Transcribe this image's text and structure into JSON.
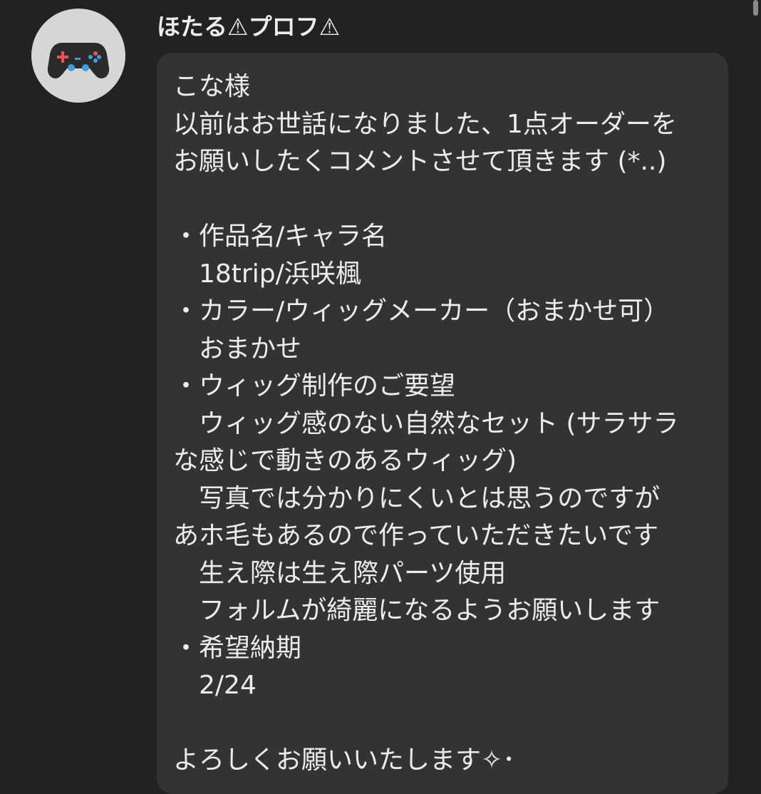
{
  "message": {
    "sender_name": "ほたる⚠プロフ⚠",
    "avatar_icon": "gamepad-icon",
    "avatar_background": "#d6d6d6",
    "lines": [
      "こな様",
      "以前はお世話になりました、1点オーダーを",
      "お願いしたくコメントさせて頂きます (*..)",
      "",
      "・作品名/キャラ名",
      "　18trip/浜咲楓",
      "・カラー/ウィッグメーカー（おまかせ可）",
      "　おまかせ",
      "・ウィッグ制作のご要望",
      "　ウィッグ感のない自然なセット (サラサラ",
      "な感じで動きのあるウィッグ)",
      "　写真では分かりにくいとは思うのですが",
      "あホ毛もあるので作っていただきたいです",
      "　生え際は生え際パーツ使用",
      "　フォルムが綺麗になるようお願いします",
      "・希望納期",
      "　2/24",
      "",
      "よろしくお願いいたします✧･"
    ]
  },
  "colors": {
    "background": "#222222",
    "bubble": "#333333",
    "text": "#ececec"
  }
}
